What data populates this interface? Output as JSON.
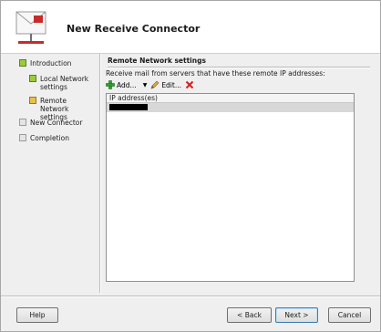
{
  "window": {
    "title": "New Receive Connector"
  },
  "nav": {
    "items": [
      {
        "label": "Introduction",
        "status": "complete"
      },
      {
        "label": "Local Network settings",
        "status": "complete"
      },
      {
        "label": "Remote Network settings",
        "status": "current"
      },
      {
        "label": "New Connector",
        "status": "pending"
      },
      {
        "label": "Completion",
        "status": "pending"
      }
    ]
  },
  "content": {
    "section_title": "Remote Network settings",
    "description": "Receive mail from servers that have these remote IP addresses:",
    "toolbar": {
      "add_label": "Add...",
      "edit_label": "Edit..."
    },
    "list": {
      "column_header": "IP address(es)",
      "rows": [
        {
          "value": "[redacted]"
        }
      ]
    }
  },
  "footer": {
    "help_label": "Help",
    "back_label": "< Back",
    "next_label": "Next >",
    "cancel_label": "Cancel"
  },
  "colors": {
    "complete": "#9bcc3c",
    "current": "#e8c04a",
    "pending": "#e4e4e4"
  }
}
